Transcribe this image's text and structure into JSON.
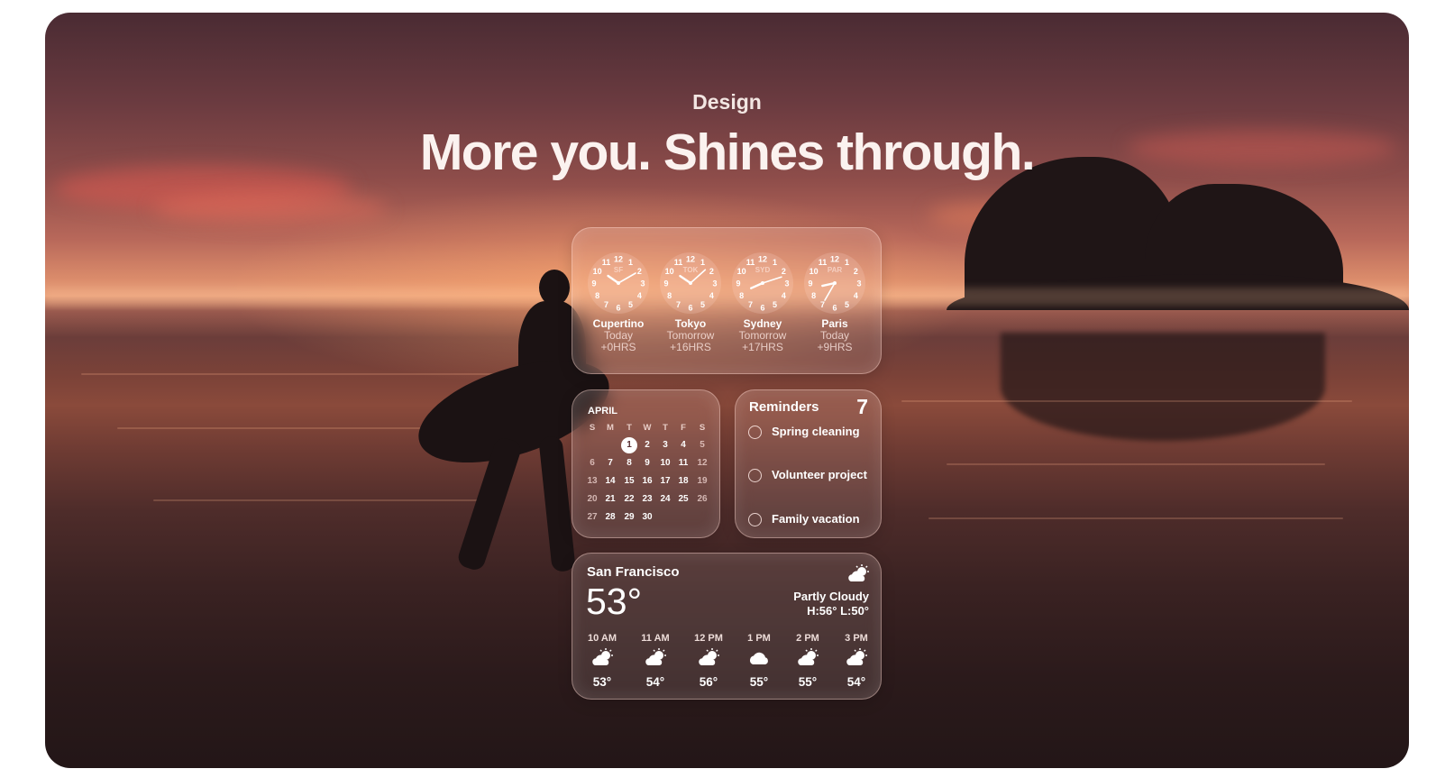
{
  "section": {
    "eyebrow": "Design",
    "headline": "More you. Shines through."
  },
  "world_clock": {
    "clocks": [
      {
        "city": "Cupertino",
        "code": "SF",
        "day": "Today",
        "offset": "+0HRS"
      },
      {
        "city": "Tokyo",
        "code": "TOK",
        "day": "Tomorrow",
        "offset": "+16HRS"
      },
      {
        "city": "Sydney",
        "code": "SYD",
        "day": "Tomorrow",
        "offset": "+17HRS"
      },
      {
        "city": "Paris",
        "code": "PAR",
        "day": "Today",
        "offset": "+9HRS"
      }
    ]
  },
  "calendar": {
    "month": "APRIL",
    "weekdays": [
      "S",
      "M",
      "T",
      "W",
      "T",
      "F",
      "S"
    ],
    "weeks": [
      [
        "",
        "",
        "1",
        "2",
        "3",
        "4",
        "5"
      ],
      [
        "6",
        "7",
        "8",
        "9",
        "10",
        "11",
        "12"
      ],
      [
        "13",
        "14",
        "15",
        "16",
        "17",
        "18",
        "19"
      ],
      [
        "20",
        "21",
        "22",
        "23",
        "24",
        "25",
        "26"
      ],
      [
        "27",
        "28",
        "29",
        "30",
        "",
        "",
        ""
      ]
    ],
    "today": "1"
  },
  "reminders": {
    "title": "Reminders",
    "count": "7",
    "items": [
      "Spring cleaning",
      "Volunteer project",
      "Family vacation"
    ]
  },
  "weather": {
    "location": "San Francisco",
    "temperature": "53°",
    "condition": "Partly Cloudy",
    "high_low": "H:56° L:50°",
    "icon": "partly-cloudy-icon",
    "hourly": [
      {
        "time": "10 AM",
        "icon": "partly-cloudy-icon",
        "temp": "53°"
      },
      {
        "time": "11 AM",
        "icon": "partly-cloudy-icon",
        "temp": "54°"
      },
      {
        "time": "12 PM",
        "icon": "partly-cloudy-icon",
        "temp": "56°"
      },
      {
        "time": "1 PM",
        "icon": "cloud-icon",
        "temp": "55°"
      },
      {
        "time": "2 PM",
        "icon": "partly-cloudy-icon",
        "temp": "55°"
      },
      {
        "time": "3 PM",
        "icon": "partly-cloudy-icon",
        "temp": "54°"
      }
    ]
  }
}
